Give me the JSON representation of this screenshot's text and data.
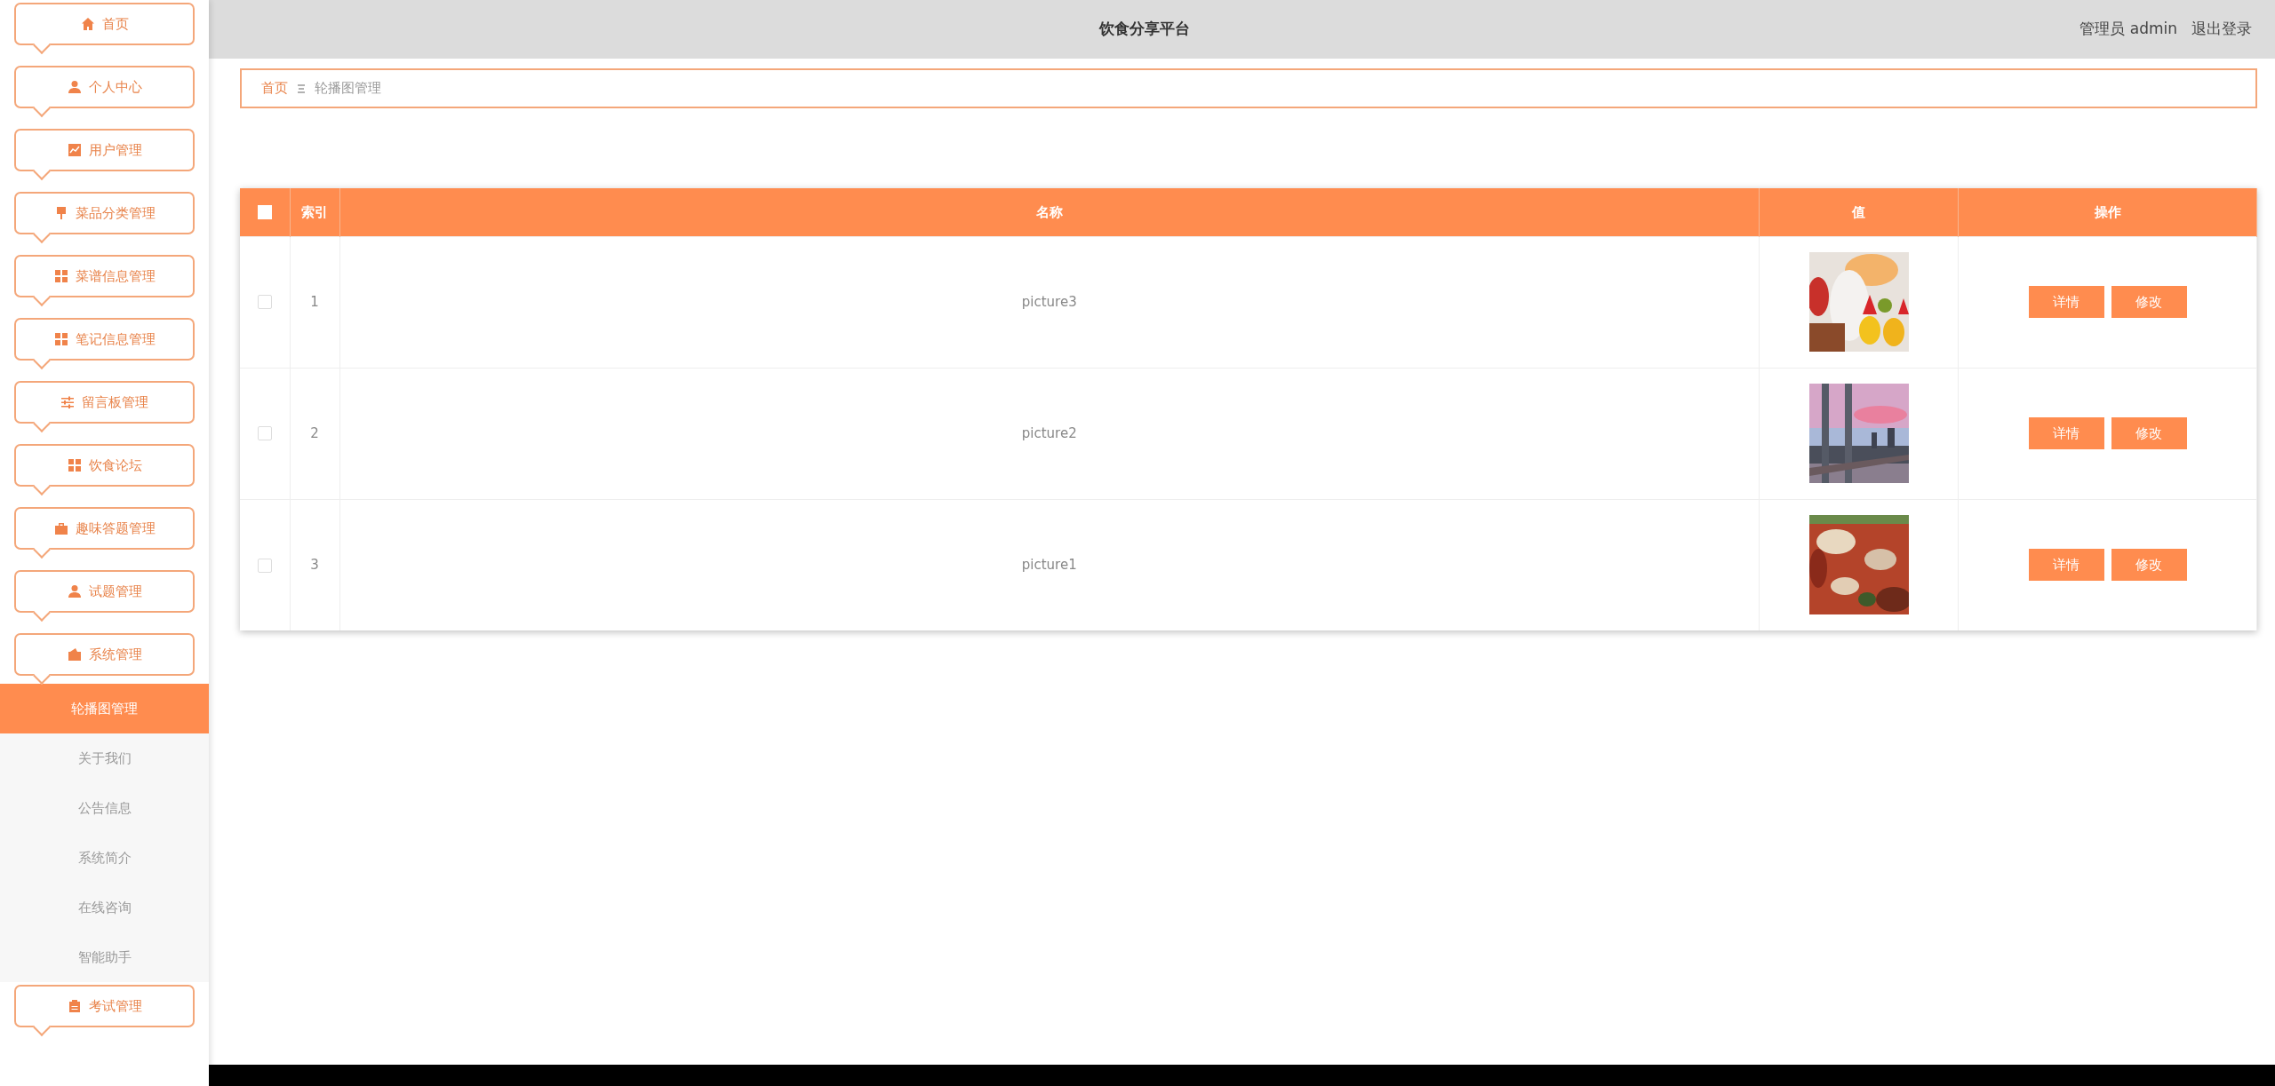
{
  "header": {
    "title": "饮食分享平台",
    "user": "管理员 admin",
    "logout": "退出登录"
  },
  "breadcrumb": [
    "首页",
    "轮播图管理"
  ],
  "sidebar": {
    "items": [
      {
        "label": "首页",
        "selected": false
      },
      {
        "label": "个人中心",
        "selected": false
      },
      {
        "label": "用户管理",
        "selected": false
      },
      {
        "label": "菜品分类管理",
        "selected": false
      },
      {
        "label": "菜谱信息管理",
        "selected": false
      },
      {
        "label": "笔记信息管理",
        "selected": false
      },
      {
        "label": "留言板管理",
        "selected": false
      },
      {
        "label": "饮食论坛",
        "selected": false
      },
      {
        "label": "趣味答题管理",
        "selected": false
      },
      {
        "label": "试题管理",
        "selected": false
      },
      {
        "label": "系统管理",
        "selected": false,
        "expanded": true,
        "children": [
          {
            "label": "轮播图管理",
            "selected": true
          },
          {
            "label": "关于我们",
            "selected": false
          },
          {
            "label": "公告信息",
            "selected": false
          },
          {
            "label": "系统简介",
            "selected": false
          },
          {
            "label": "在线咨询",
            "selected": false
          },
          {
            "label": "智能助手",
            "selected": false
          }
        ]
      },
      {
        "label": "考试管理",
        "selected": false
      }
    ]
  },
  "table": {
    "select_all_checked": false,
    "columns": [
      "索引",
      "名称",
      "值",
      "操作"
    ],
    "rows": [
      {
        "checked": false,
        "index": "1",
        "name": "picture3",
        "value": {
          "kind": "picture"
        },
        "actions": [
          "详情",
          "修改"
        ]
      },
      {
        "checked": false,
        "index": "2",
        "name": "picture2",
        "value": {
          "kind": "picture"
        },
        "actions": [
          "详情",
          "修改"
        ]
      },
      {
        "checked": false,
        "index": "3",
        "name": "picture1",
        "value": {
          "kind": "picture"
        },
        "actions": [
          "详情",
          "修改"
        ]
      }
    ]
  }
}
